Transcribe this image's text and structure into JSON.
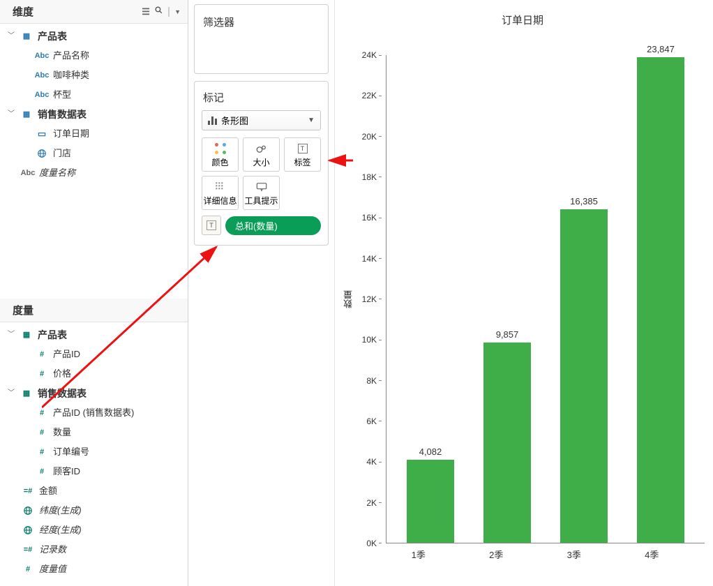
{
  "dimensions": {
    "header": "维度",
    "tables": [
      {
        "name": "产品表",
        "fields": [
          {
            "icon": "Abc",
            "label": "产品名称"
          },
          {
            "icon": "Abc",
            "label": "咖啡种类"
          },
          {
            "icon": "Abc",
            "label": "杯型"
          }
        ]
      },
      {
        "name": "销售数据表",
        "fields": [
          {
            "icon": "date",
            "label": "订单日期"
          },
          {
            "icon": "globe",
            "label": "门店"
          }
        ]
      }
    ],
    "meta_field": {
      "icon": "Abc",
      "label": "度量名称"
    }
  },
  "measures": {
    "header": "度量",
    "tables": [
      {
        "name": "产品表",
        "fields": [
          {
            "icon": "#",
            "label": "产品ID"
          },
          {
            "icon": "#",
            "label": "价格"
          }
        ]
      },
      {
        "name": "销售数据表",
        "fields": [
          {
            "icon": "#",
            "label": "产品ID (销售数据表)"
          },
          {
            "icon": "#",
            "label": "数量"
          },
          {
            "icon": "#",
            "label": "订单编号"
          },
          {
            "icon": "#",
            "label": "顾客ID"
          }
        ]
      }
    ],
    "extra": [
      {
        "icon": "=#",
        "label": "金额"
      },
      {
        "icon": "globe",
        "label": "纬度(生成)",
        "italic": true
      },
      {
        "icon": "globe",
        "label": "经度(生成)",
        "italic": true
      },
      {
        "icon": "=#",
        "label": "记录数",
        "italic": true
      },
      {
        "icon": "#",
        "label": "度量值",
        "italic": true
      }
    ]
  },
  "filters": {
    "title": "筛选器"
  },
  "marks": {
    "title": "标记",
    "dropdown": "条形图",
    "cells": {
      "color": "颜色",
      "size": "大小",
      "label": "标签",
      "detail": "详细信息",
      "tooltip": "工具提示"
    },
    "pill": "总和(数量)"
  },
  "chart_data": {
    "type": "bar",
    "title": "订单日期",
    "ylabel": "数量",
    "xlabel": "",
    "categories": [
      "1季",
      "2季",
      "3季",
      "4季"
    ],
    "values": [
      4082,
      9857,
      16385,
      23847
    ],
    "value_labels": [
      "4,082",
      "9,857",
      "16,385",
      "23,847"
    ],
    "yticks": [
      "24K",
      "22K",
      "20K",
      "18K",
      "16K",
      "14K",
      "12K",
      "10K",
      "8K",
      "6K",
      "4K",
      "2K",
      "0K"
    ],
    "ylim": [
      0,
      24000
    ]
  }
}
